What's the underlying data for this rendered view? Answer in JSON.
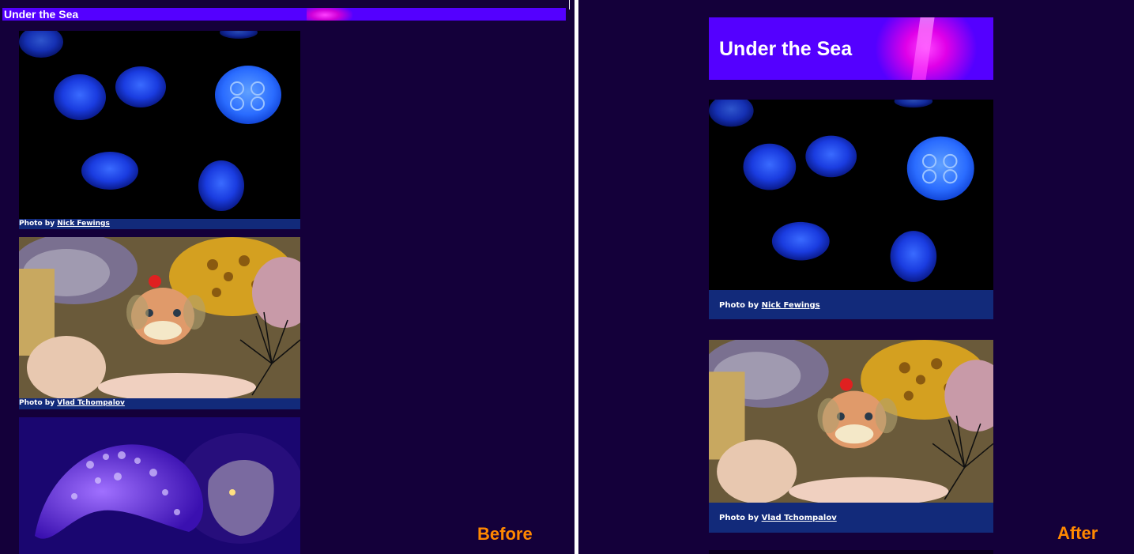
{
  "left_panel": {
    "label": "Before",
    "site_title": "Under the Sea",
    "photos": [
      {
        "alt": "jellyfish",
        "credit_prefix": "Photo by",
        "credit_name": "Nick Fewings"
      },
      {
        "alt": "pufferfish on coral reef",
        "credit_prefix": "Photo by",
        "credit_name": "Vlad Tchompalov"
      },
      {
        "alt": "moray eels"
      }
    ]
  },
  "right_panel": {
    "label": "After",
    "site_title": "Under the Sea",
    "photos": [
      {
        "alt": "jellyfish",
        "credit_prefix": "Photo by",
        "credit_name": "Nick Fewings"
      },
      {
        "alt": "pufferfish on coral reef",
        "credit_prefix": "Photo by",
        "credit_name": "Vlad Tchompalov"
      }
    ]
  },
  "colors": {
    "page_background": "#14003a",
    "banner": "#5400ff",
    "caption_bar": "#122a7a",
    "label": "#ff8800",
    "divider": "#ffffff"
  }
}
